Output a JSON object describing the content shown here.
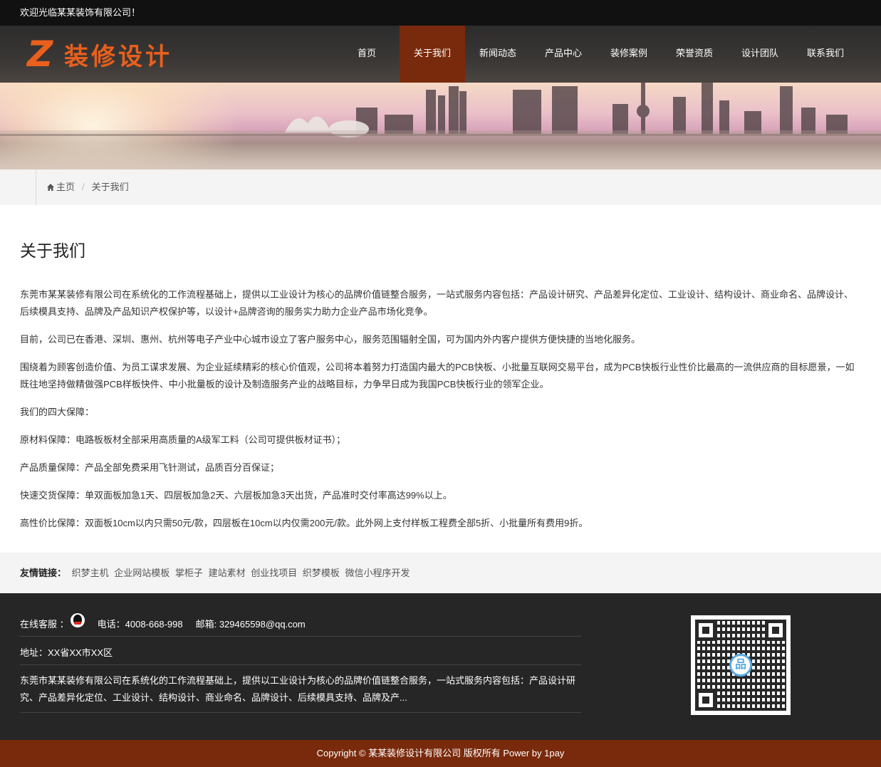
{
  "topbar": {
    "welcome": "欢迎光临某某装饰有限公司！"
  },
  "header": {
    "logo_letter": "Z",
    "logo_text": "装修设计",
    "nav": [
      {
        "label": "首页",
        "active": false
      },
      {
        "label": "关于我们",
        "active": true
      },
      {
        "label": "新闻动态",
        "active": false
      },
      {
        "label": "产品中心",
        "active": false
      },
      {
        "label": "装修案例",
        "active": false
      },
      {
        "label": "荣誉资质",
        "active": false
      },
      {
        "label": "设计团队",
        "active": false
      },
      {
        "label": "联系我们",
        "active": false
      }
    ]
  },
  "breadcrumb": {
    "home": "主页",
    "separator": "/",
    "current": "关于我们"
  },
  "content": {
    "title": "关于我们",
    "paragraphs": [
      "东莞市某某装修有限公司在系统化的工作流程基础上，提供以工业设计为核心的品牌价值链整合服务，一站式服务内容包括：产品设计研究、产品差异化定位、工业设计、结构设计、商业命名、品牌设计、后续模具支持、品牌及产品知识产权保护等，以设计+品牌咨询的服务实力助力企业产品市场化竞争。",
      "目前，公司已在香港、深圳、惠州、杭州等电子产业中心城市设立了客户服务中心，服务范围辐射全国，可为国内外内客户提供方便快捷的当地化服务。",
      "围绕着为顾客创造价值、为员工谋求发展、为企业延续精彩的核心价值观，公司将本着努力打造国内最大的PCB快板、小批量互联网交易平台，成为PCB快板行业性价比最高的一流供应商的目标愿景，一如既往地坚持做精做强PCB样板快件、中小批量板的设计及制造服务产业的战略目标，力争早日成为我国PCB快板行业的领军企业。",
      "我们的四大保障：",
      "原材料保障：电路板板材全部采用高质量的A级军工料（公司可提供板材证书）；",
      "产品质量保障：产品全部免费采用飞针测试，品质百分百保证；",
      "快速交货保障：单双面板加急1天、四层板加急2天、六层板加急3天出货，产品准时交付率高达99%以上。",
      "高性价比保障：双面板10cm以内只需50元/款，四层板在10cm以内仅需200元/款。此外网上支付样板工程费全部5折、小批量所有费用9折。"
    ]
  },
  "links": {
    "label": "友情链接：",
    "items": [
      "织梦主机",
      "企业网站模板",
      "掌柜子",
      "建站素材",
      "创业找项目",
      "织梦模板",
      "微信小程序开发"
    ]
  },
  "footer": {
    "service_label": "在线客服 ：",
    "phone": "电话：4008-668-998",
    "email": "邮箱: 329465598@qq.com",
    "address": "地址：XX省XX市XX区",
    "description": "东莞市某某装修有限公司在系统化的工作流程基础上，提供以工业设计为核心的品牌价值链整合服务，一站式服务内容包括：产品设计研究、产品差异化定位、工业设计、结构设计、商业命名、品牌设计、后续模具支持、品牌及产...",
    "qr_logo": "品"
  },
  "copyright": {
    "text": "Copyright © 某某装修设计有限公司 版权所有  Power by 1pay"
  },
  "colors": {
    "accent": "#7a2a0c",
    "logo": "#e8601c",
    "footer_bg": "#262626"
  }
}
